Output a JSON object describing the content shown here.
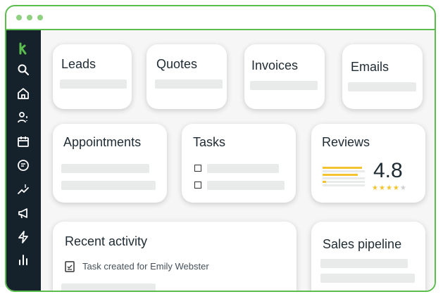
{
  "cards": {
    "leads": {
      "title": "Leads"
    },
    "quotes": {
      "title": "Quotes"
    },
    "invoices": {
      "title": "Invoices"
    },
    "emails": {
      "title": "Emails"
    },
    "appointments": {
      "title": "Appointments"
    },
    "tasks": {
      "title": "Tasks"
    },
    "reviews": {
      "title": "Reviews",
      "rating": "4.8",
      "stars_filled": 4,
      "stars_total": 5
    },
    "recent_activity": {
      "title": "Recent activity",
      "item": "Task created for Emily Webster"
    },
    "sales_pipeline": {
      "title": "Sales pipeline"
    }
  },
  "sidebar": {
    "icons": [
      "logo-icon",
      "search-icon",
      "home-icon",
      "contacts-icon",
      "calendar-icon",
      "chat-icon",
      "sales-icon",
      "megaphone-icon",
      "lightning-icon",
      "reports-icon"
    ]
  },
  "colors": {
    "accent": "#5cbd4f",
    "sidebar_bg": "#15222c",
    "star": "#f4c430",
    "star_empty": "#cfcfcf"
  }
}
